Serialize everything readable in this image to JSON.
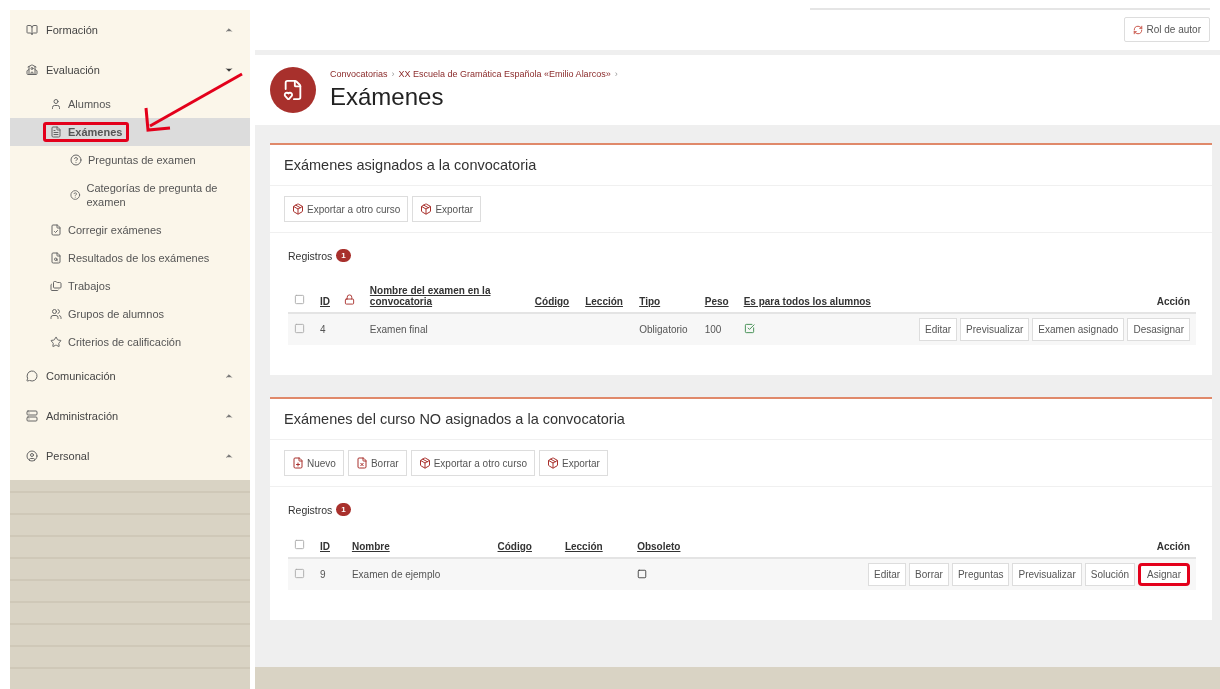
{
  "sidebar": {
    "sections": [
      {
        "label": "Formación",
        "expanded": false
      },
      {
        "label": "Evaluación",
        "expanded": true,
        "children": [
          {
            "label": "Alumnos",
            "selected": false,
            "highlighted": false
          },
          {
            "label": "Exámenes",
            "selected": true,
            "highlighted": true,
            "children": [
              {
                "label": "Preguntas de examen",
                "selected": false,
                "highlighted": false
              },
              {
                "label": "Categorías de pregunta de examen",
                "selected": false,
                "highlighted": false
              }
            ]
          },
          {
            "label": "Corregir exámenes",
            "selected": false,
            "highlighted": false
          },
          {
            "label": "Resultados de los exámenes",
            "selected": false,
            "highlighted": false
          },
          {
            "label": "Trabajos",
            "selected": false,
            "highlighted": false
          },
          {
            "label": "Grupos de alumnos",
            "selected": false,
            "highlighted": false
          },
          {
            "label": "Criterios de calificación",
            "selected": false,
            "highlighted": false
          }
        ]
      },
      {
        "label": "Comunicación",
        "expanded": false
      },
      {
        "label": "Administración",
        "expanded": false
      },
      {
        "label": "Personal",
        "expanded": false
      }
    ]
  },
  "top_bar": {
    "role_button": "Rol de autor"
  },
  "header": {
    "breadcrumb": [
      {
        "label": "Convocatorias",
        "separator": "›"
      },
      {
        "label": "XX Escuela de Gramática Española «Emilio Alarcos»",
        "separator": "›"
      }
    ],
    "title": "Exámenes"
  },
  "panels": [
    {
      "title": "Exámenes asignados a la convocatoria",
      "toolbar": [
        {
          "label": "Exportar a otro curso",
          "kind": "export"
        },
        {
          "label": "Exportar",
          "kind": "export"
        }
      ],
      "records_label": "Registros",
      "records_count": "1",
      "columns": [
        {
          "kind": "check",
          "checked": false
        },
        {
          "kind": "text",
          "label": "ID"
        },
        {
          "kind": "lock"
        },
        {
          "kind": "text",
          "label": "Nombre del examen en la convocatoria"
        },
        {
          "kind": "text",
          "label": "Código"
        },
        {
          "kind": "text",
          "label": "Lección"
        },
        {
          "kind": "text",
          "label": "Tipo"
        },
        {
          "kind": "text",
          "label": "Peso"
        },
        {
          "kind": "text",
          "label": "Es para todos los alumnos"
        },
        {
          "kind": "action",
          "label": "Acción"
        }
      ],
      "rows": [
        {
          "cells": [
            {
              "kind": "check",
              "checked": false
            },
            "4",
            "",
            "Examen final",
            "",
            "",
            "Obligatorio",
            "100",
            {
              "kind": "flag",
              "checked": true
            },
            {
              "kind": "actions",
              "buttons": [
                {
                  "label": "Editar",
                  "highlighted": false
                },
                {
                  "label": "Previsualizar",
                  "highlighted": false
                },
                {
                  "label": "Examen asignado",
                  "highlighted": false
                },
                {
                  "label": "Desasignar",
                  "highlighted": false
                }
              ]
            }
          ]
        }
      ]
    },
    {
      "title": "Exámenes del curso NO asignados a la convocatoria",
      "toolbar": [
        {
          "label": "Nuevo",
          "kind": "new"
        },
        {
          "label": "Borrar",
          "kind": "delete"
        },
        {
          "label": "Exportar a otro curso",
          "kind": "export"
        },
        {
          "label": "Exportar",
          "kind": "export"
        }
      ],
      "records_label": "Registros",
      "records_count": "1",
      "columns": [
        {
          "kind": "check",
          "checked": false
        },
        {
          "kind": "text",
          "label": "ID"
        },
        {
          "kind": "text",
          "label": "Nombre"
        },
        {
          "kind": "text",
          "label": "Código"
        },
        {
          "kind": "text",
          "label": "Lección"
        },
        {
          "kind": "text",
          "label": "Obsoleto"
        },
        {
          "kind": "action",
          "label": "Acción"
        }
      ],
      "rows": [
        {
          "cells": [
            {
              "kind": "check",
              "checked": false
            },
            "9",
            "Examen de ejemplo",
            "",
            "",
            {
              "kind": "flag",
              "checked": false
            },
            {
              "kind": "actions",
              "buttons": [
                {
                  "label": "Editar",
                  "highlighted": false
                },
                {
                  "label": "Borrar",
                  "highlighted": false
                },
                {
                  "label": "Preguntas",
                  "highlighted": false
                },
                {
                  "label": "Previsualizar",
                  "highlighted": false
                },
                {
                  "label": "Solución",
                  "highlighted": false
                },
                {
                  "label": "Asignar",
                  "highlighted": true
                }
              ]
            }
          ]
        }
      ]
    }
  ]
}
